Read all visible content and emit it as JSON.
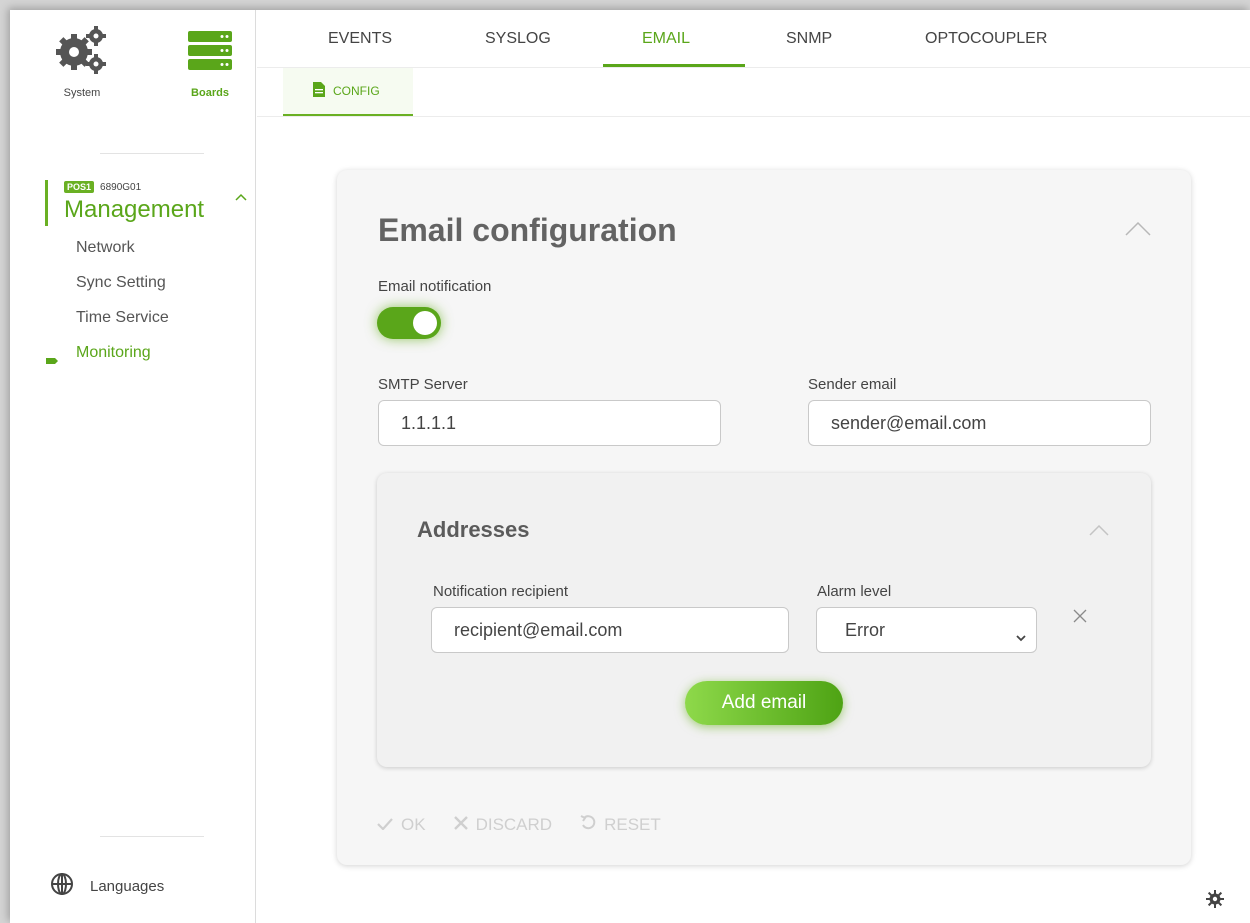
{
  "sidebar": {
    "top_icons": [
      {
        "label": "System",
        "icon": "gears-icon"
      },
      {
        "label": "Boards",
        "icon": "server-stack-icon"
      }
    ],
    "position_badge": "POS1",
    "position_code": "6890G01",
    "section_title": "Management",
    "items": [
      {
        "label": "Network"
      },
      {
        "label": "Sync Setting"
      },
      {
        "label": "Time Service"
      },
      {
        "label": "Monitoring",
        "active": true
      }
    ],
    "languages_label": "Languages"
  },
  "tabs": [
    {
      "label": "EVENTS"
    },
    {
      "label": "SYSLOG"
    },
    {
      "label": "EMAIL",
      "active": true
    },
    {
      "label": "SNMP"
    },
    {
      "label": "OPTOCOUPLER"
    }
  ],
  "subtab": {
    "label": "CONFIG",
    "icon": "document-icon"
  },
  "email_config": {
    "title": "Email configuration",
    "notification_label": "Email notification",
    "notification_enabled": true,
    "smtp_label": "SMTP Server",
    "smtp_value": "1.1.1.1",
    "sender_label": "Sender email",
    "sender_value": "sender@email.com",
    "addresses": {
      "title": "Addresses",
      "recipient_label": "Notification recipient",
      "recipient_value": "recipient@email.com",
      "alarm_label": "Alarm level",
      "alarm_value": "Error",
      "add_button": "Add email"
    },
    "actions": {
      "ok": "OK",
      "discard": "DISCARD",
      "reset": "RESET"
    }
  },
  "colors": {
    "accent": "#5aa61a",
    "card_bg": "#f6f6f6"
  }
}
